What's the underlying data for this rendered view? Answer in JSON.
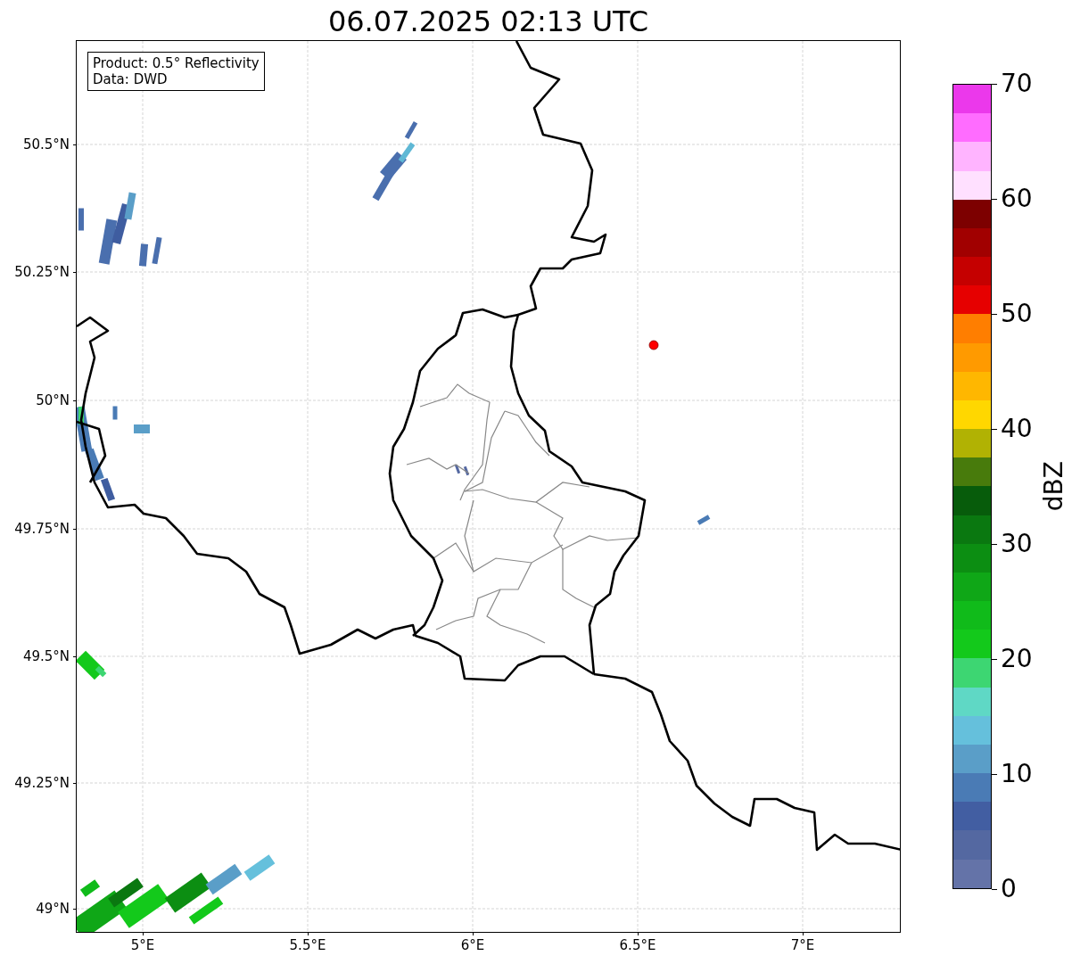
{
  "title": "06.07.2025 02:13 UTC",
  "map": {
    "info_lines": [
      "Product: 0.5° Reflectivity",
      "Data: DWD"
    ],
    "yticks": [
      "50.5°N",
      "50.25°N",
      "50°N",
      "49.75°N",
      "49.5°N",
      "49.25°N",
      "49°N"
    ],
    "xticks": [
      "5°E",
      "5.5°E",
      "6°E",
      "6.5°E",
      "7°E"
    ]
  },
  "colorbar": {
    "label": "dBZ",
    "ticks": [
      "70",
      "60",
      "50",
      "40",
      "30",
      "20",
      "10",
      "0"
    ],
    "segments": [
      {
        "color": "#eb38eb"
      },
      {
        "color": "#ff6cff"
      },
      {
        "color": "#ffb4ff"
      },
      {
        "color": "#ffe0ff"
      },
      {
        "color": "#7d0000"
      },
      {
        "color": "#a10000"
      },
      {
        "color": "#c50000"
      },
      {
        "color": "#e60000"
      },
      {
        "color": "#ff7e00"
      },
      {
        "color": "#ff9a00"
      },
      {
        "color": "#ffb700"
      },
      {
        "color": "#ffd700"
      },
      {
        "color": "#b1b203"
      },
      {
        "color": "#487b0c"
      },
      {
        "color": "#075c0b"
      },
      {
        "color": "#0a7810"
      },
      {
        "color": "#0c8e12"
      },
      {
        "color": "#0fa717"
      },
      {
        "color": "#10bb1a"
      },
      {
        "color": "#13c91b"
      },
      {
        "color": "#3dd672"
      },
      {
        "color": "#5fd8c5"
      },
      {
        "color": "#65c0dc"
      },
      {
        "color": "#5a9ec8"
      },
      {
        "color": "#4a7bb5"
      },
      {
        "color": "#425ea2"
      },
      {
        "color": "#5468a1"
      },
      {
        "color": "#6473a8"
      }
    ]
  }
}
